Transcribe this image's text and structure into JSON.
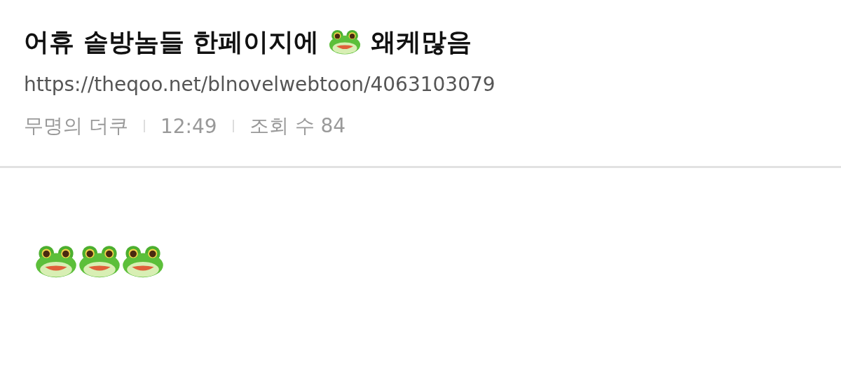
{
  "post": {
    "title": [
      {
        "kind": "text",
        "text": "어휴 솥방놈들 한페이지에"
      },
      {
        "kind": "frog"
      },
      {
        "kind": "text",
        "text": "왜케많음"
      }
    ],
    "url": "https://theqoo.net/blnovelwebtoon/4063103079",
    "meta": [
      "무명의 더쿠",
      "12:49",
      "조회 수 84"
    ],
    "body": [
      {
        "kind": "frog"
      },
      {
        "kind": "frog"
      },
      {
        "kind": "frog"
      }
    ]
  }
}
